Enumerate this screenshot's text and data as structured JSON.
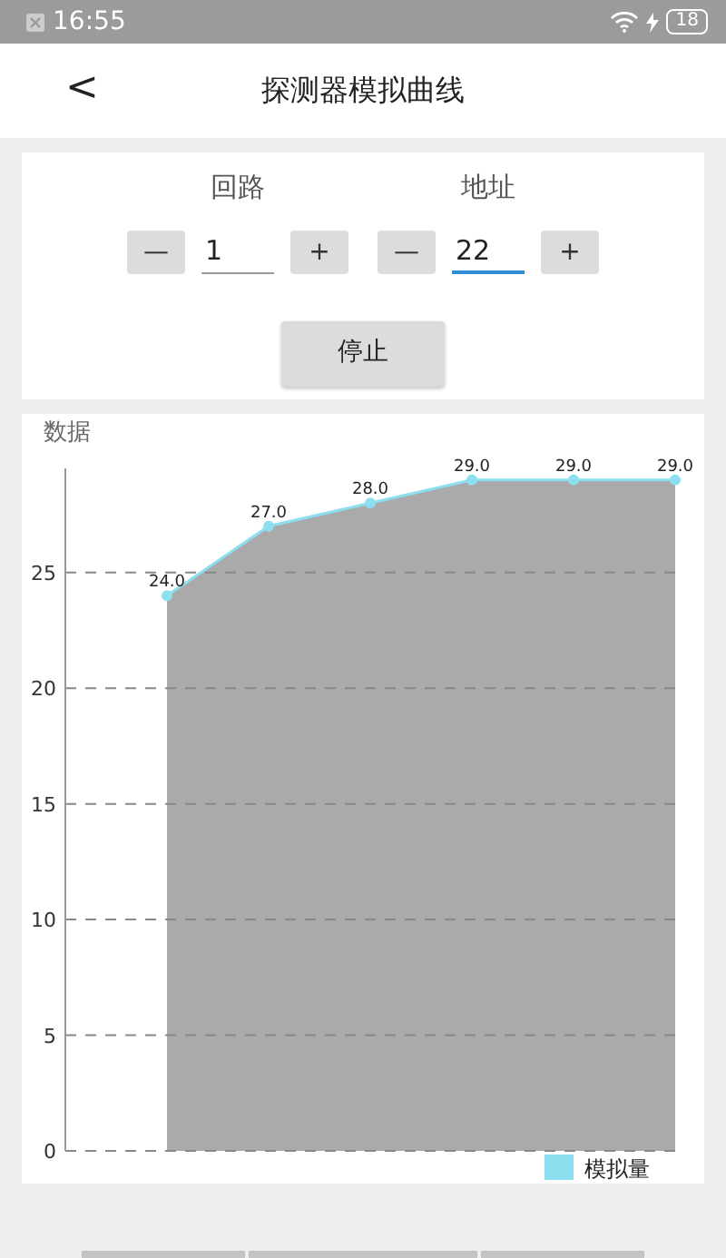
{
  "status_bar": {
    "time": "16:55",
    "battery": "18"
  },
  "header": {
    "back": "<",
    "title": "探测器模拟曲线"
  },
  "controls": {
    "fields": [
      {
        "label": "回路",
        "minus": "—",
        "value": "1",
        "plus": "+",
        "focused": false
      },
      {
        "label": "地址",
        "minus": "—",
        "value": "22",
        "plus": "+",
        "focused": true
      }
    ],
    "stop_button": "停止"
  },
  "chart_panel": {
    "title": "数据",
    "chart_data": {
      "type": "area",
      "categories": [
        null,
        null,
        null,
        null,
        null,
        null
      ],
      "ylim": [
        0,
        29.5
      ],
      "yticks": [
        0,
        5,
        10,
        15,
        20,
        25
      ],
      "grid": true,
      "value_labels": [
        "24.0",
        "27.0",
        "28.0",
        "29.0",
        "29.0",
        "29.0"
      ],
      "series": [
        {
          "name": "模拟量",
          "color": "#8ddff0",
          "values": [
            24.0,
            27.0,
            28.0,
            29.0,
            29.0,
            29.0
          ]
        }
      ]
    }
  }
}
